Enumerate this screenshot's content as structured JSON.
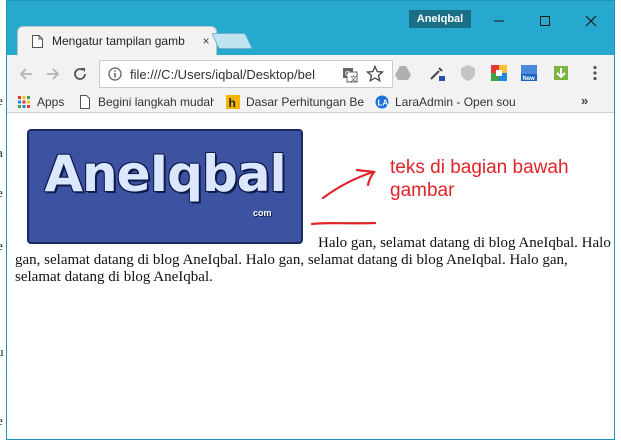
{
  "window": {
    "user_badge": "AneIqbal"
  },
  "tab": {
    "title": "Mengatur tampilan gamb",
    "close_glyph": "×"
  },
  "address_bar": {
    "url": "file:///C:/Users/iqbal/Desktop/bel"
  },
  "bookmarks": {
    "items": [
      {
        "label": "Apps",
        "icon": "apps-grid-icon"
      },
      {
        "label": "Begini langkah mudah",
        "icon": "page-icon"
      },
      {
        "label": "Dasar Perhitungan Be",
        "icon": "h-logo-icon"
      },
      {
        "label": "LaraAdmin - Open sou",
        "icon": "laraadmin-icon"
      }
    ],
    "more_glyph": "»"
  },
  "page": {
    "logo_text": "AneIqbal",
    "logo_sub": "com",
    "annotation": "teks di bagian bawah gambar",
    "paragraph": "Halo gan, selamat datang di blog AneIqbal. Halo gan, selamat datang di blog AneIqbal. Halo gan, selamat datang di blog AneIqbal. Halo gan, selamat datang di blog AneIqbal."
  },
  "colors": {
    "titlebar": "#27a8cf",
    "annotation": "#e0242a",
    "logo_background": "#3d52a1"
  }
}
